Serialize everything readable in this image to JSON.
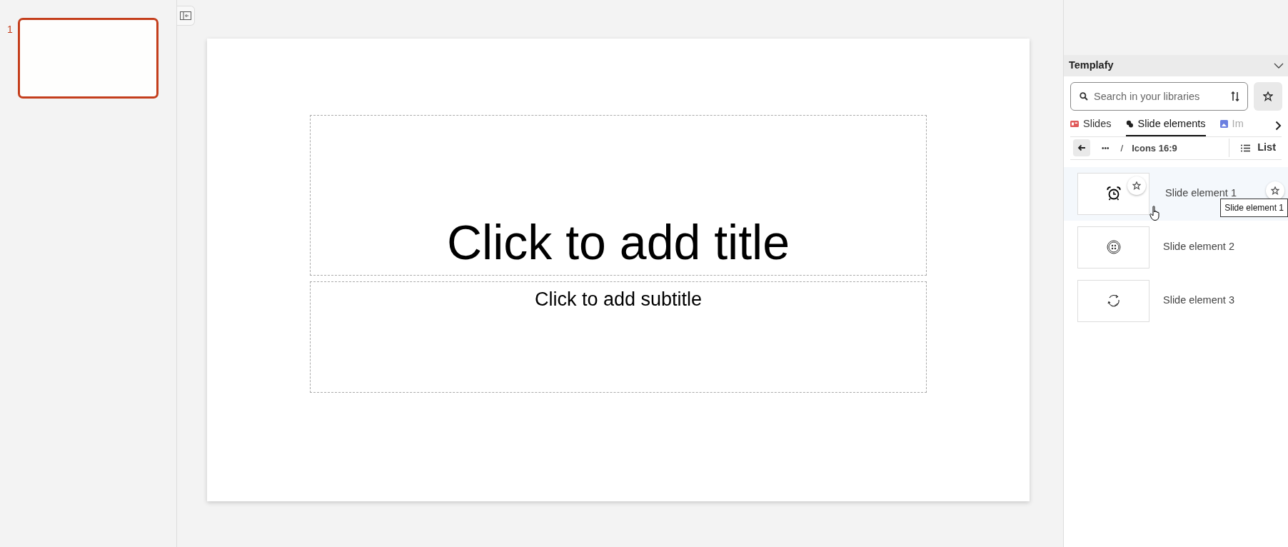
{
  "slide_panel": {
    "slides": [
      {
        "number": "1",
        "selected": true
      }
    ]
  },
  "slide": {
    "title_placeholder": "Click to add title",
    "subtitle_placeholder": "Click to add subtitle"
  },
  "addin": {
    "title": "Templafy",
    "search": {
      "placeholder": "Search in your libraries"
    },
    "tabs": [
      {
        "label": "Slides",
        "kind": "slides",
        "selected": false
      },
      {
        "label": "Slide elements",
        "kind": "elements",
        "selected": true
      },
      {
        "label": "Im",
        "kind": "images",
        "selected": false
      }
    ],
    "breadcrumb": {
      "ellipsis": "•••",
      "separator": "/",
      "current": "Icons 16:9"
    },
    "view_button": "List",
    "items": [
      {
        "name": "Slide element 1",
        "kind": "alarm",
        "hovered": true
      },
      {
        "name": "Slide element 2",
        "kind": "button",
        "hovered": false
      },
      {
        "name": "Slide element 3",
        "kind": "cycle",
        "hovered": false
      }
    ],
    "tooltip": "Slide element 1"
  }
}
